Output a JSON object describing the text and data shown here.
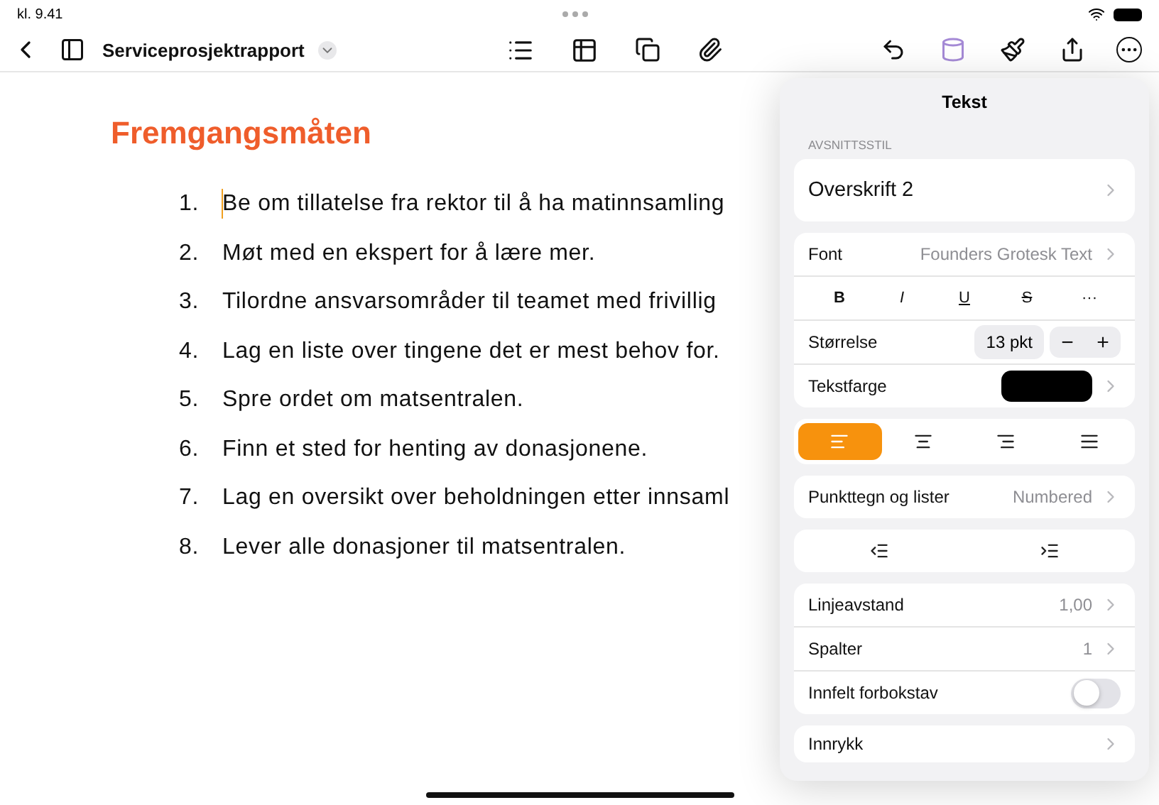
{
  "status_bar": {
    "time": "kl. 9.41"
  },
  "toolbar": {
    "title": "Serviceprosjektrapport"
  },
  "document": {
    "heading": "Fremgangsmåten",
    "items": [
      {
        "number": "1.",
        "text": "Be om tillatelse fra rektor til å ha matinnsamling",
        "cursor": true
      },
      {
        "number": "2.",
        "text": "Møt med en ekspert for å lære mer.",
        "cursor": false
      },
      {
        "number": "3.",
        "text": "Tilordne ansvarsområder til teamet med frivillig",
        "cursor": false
      },
      {
        "number": "4.",
        "text": "Lag en liste over tingene det er mest behov for.",
        "cursor": false
      },
      {
        "number": "5.",
        "text": "Spre ordet om matsentralen.",
        "cursor": false
      },
      {
        "number": "6.",
        "text": "Finn et sted for henting av donasjonene.",
        "cursor": false
      },
      {
        "number": "7.",
        "text": "Lag en oversikt over beholdningen etter innsaml",
        "cursor": false
      },
      {
        "number": "8.",
        "text": "Lever alle donasjoner til matsentralen.",
        "cursor": false
      }
    ]
  },
  "panel": {
    "title": "Tekst",
    "section_label": "AVSNITTSSTIL",
    "paragraph_style": "Overskrift 2",
    "font": {
      "label": "Font",
      "value": "Founders Grotesk Text"
    },
    "format_buttons": [
      {
        "kind": "bold",
        "label": "B"
      },
      {
        "kind": "italic",
        "label": "I"
      },
      {
        "kind": "underline",
        "label": "U"
      },
      {
        "kind": "strike",
        "label": "S"
      },
      {
        "kind": "more",
        "label": "···"
      }
    ],
    "size": {
      "label": "Størrelse",
      "value": "13 pkt",
      "minus": "−",
      "plus": "+"
    },
    "text_color": {
      "label": "Tekstfarge",
      "color": "#000000"
    },
    "alignment": [
      {
        "kind": "left",
        "selected": true
      },
      {
        "kind": "center",
        "selected": false
      },
      {
        "kind": "right",
        "selected": false
      },
      {
        "kind": "justify",
        "selected": false
      }
    ],
    "bullets": {
      "label": "Punkttegn og lister",
      "value": "Numbered"
    },
    "line_spacing": {
      "label": "Linjeavstand",
      "value": "1,00"
    },
    "columns": {
      "label": "Spalter",
      "value": "1"
    },
    "drop_cap": {
      "label": "Innfelt forbokstav",
      "on": false
    },
    "indent": {
      "label": "Innrykk"
    }
  }
}
